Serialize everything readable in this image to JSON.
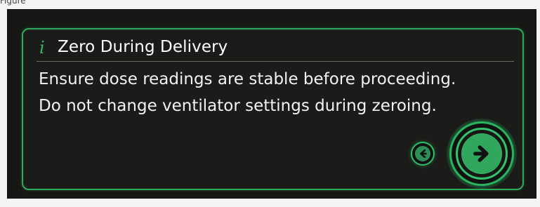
{
  "page": {
    "caption": "Figure",
    "dialog": {
      "title": "Zero During Delivery",
      "message_lines": [
        "Ensure dose readings are stable before proceeding.",
        "Do not change ventilator settings during zeroing."
      ]
    },
    "icons": {
      "info": "info-icon",
      "back": "back-arrow-icon",
      "next": "next-arrow-icon"
    },
    "colors": {
      "background": "#171715",
      "accent": "#2fa85e",
      "accent_border": "#2ea85c",
      "text": "#f2f2f2",
      "divider": "#6a6a66"
    }
  }
}
